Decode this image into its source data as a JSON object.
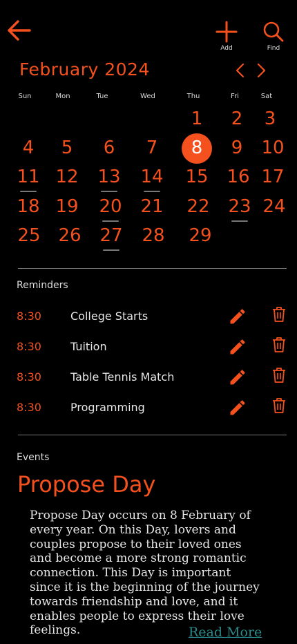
{
  "toolbar": {
    "add_label": "Add",
    "find_label": "Find"
  },
  "calendar": {
    "month_title": "February 2024",
    "weekdays": [
      "Sun",
      "Mon",
      "Tue",
      "Wed",
      "Thu",
      "Fri",
      "Sat"
    ],
    "today": 8,
    "underlined_days": [
      11,
      13,
      14,
      20,
      23,
      27
    ],
    "weeks": [
      [
        "",
        "",
        "",
        "",
        "1",
        "2",
        "3"
      ],
      [
        "4",
        "5",
        "6",
        "7",
        "8",
        "9",
        "10"
      ],
      [
        "11",
        "12",
        "13",
        "14",
        "15",
        "16",
        "17"
      ],
      [
        "18",
        "19",
        "20",
        "21",
        "22",
        "23",
        "24"
      ],
      [
        "25",
        "26",
        "27",
        "28",
        "29",
        "",
        ""
      ]
    ]
  },
  "reminders": {
    "heading": "Reminders",
    "items": [
      {
        "time": "8:30",
        "title": "College Starts"
      },
      {
        "time": "8:30",
        "title": "Tuition"
      },
      {
        "time": "8:30",
        "title": "Table Tennis Match"
      },
      {
        "time": "8:30",
        "title": "Programming"
      }
    ]
  },
  "events": {
    "heading": "Events",
    "title": "Propose Day",
    "body": "Propose Day occurs on 8 February of every year. On this Day, lovers and couples propose to their loved ones and become a more strong romantic connection. This Day is important since it is the beginning of the journey towards friendship and love, and it enables people to express their love feelings.",
    "read_more": "Read More"
  },
  "colors": {
    "accent": "#f4511e",
    "background": "#000000",
    "link": "#2b8a8a"
  },
  "icons": {
    "back": "arrow-left-icon",
    "add": "plus-icon",
    "find": "search-icon",
    "prev": "chevron-left-icon",
    "next": "chevron-right-icon",
    "edit": "pencil-icon",
    "delete": "trash-icon"
  }
}
